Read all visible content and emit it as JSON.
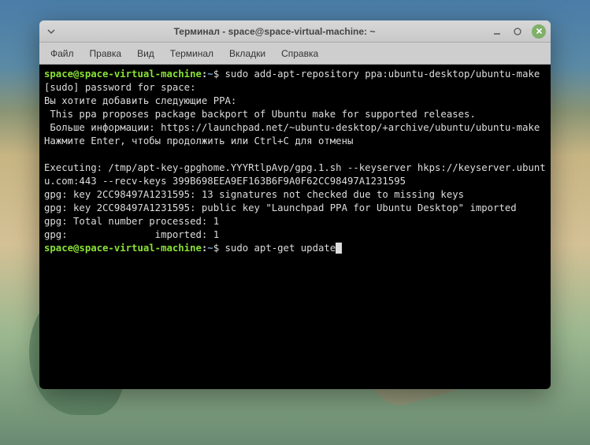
{
  "window": {
    "title": "Терминал - space@space-virtual-machine: ~"
  },
  "menubar": {
    "file": "Файл",
    "edit": "Правка",
    "view": "Вид",
    "terminal": "Терминал",
    "tabs": "Вкладки",
    "help": "Справка"
  },
  "prompt": {
    "userhost": "space@space-virtual-machine",
    "sep": ":",
    "path": "~",
    "symbol": "$"
  },
  "commands": {
    "cmd1": " sudo add-apt-repository ppa:ubuntu-desktop/ubuntu-make",
    "cmd2": " sudo apt-get update"
  },
  "output": {
    "l1": "[sudo] password for space:",
    "l2": "Вы хотите добавить следующие PPA:",
    "l3": " This ppa proposes package backport of Ubuntu make for supported releases.",
    "l4": " Больше информации: https://launchpad.net/~ubuntu-desktop/+archive/ubuntu/ubuntu-make",
    "l5": "Нажмите Enter, чтобы продолжить или Ctrl+C для отмены",
    "l6": "",
    "l7": "Executing: /tmp/apt-key-gpghome.YYYRtlpAvp/gpg.1.sh --keyserver hkps://keyserver.ubuntu.com:443 --recv-keys 399B698EEA9EF163B6F9A0F62CC98497A1231595",
    "l8": "gpg: key 2CC98497A1231595: 13 signatures not checked due to missing keys",
    "l9": "gpg: key 2CC98497A1231595: public key \"Launchpad PPA for Ubuntu Desktop\" imported",
    "l10": "gpg: Total number processed: 1",
    "l11": "gpg:               imported: 1"
  }
}
